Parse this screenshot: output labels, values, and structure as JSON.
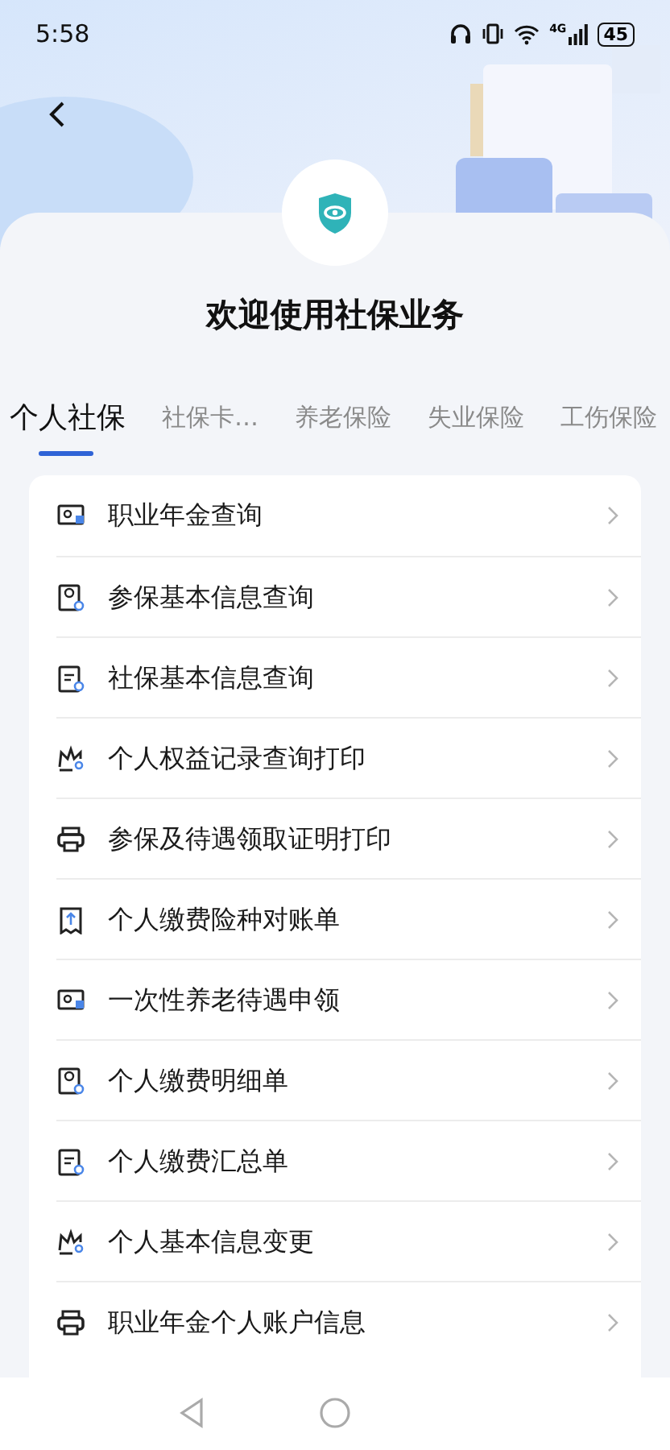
{
  "status_bar": {
    "time": "5:58",
    "network": "4G",
    "battery": "45"
  },
  "header": {
    "title": "欢迎使用社保业务"
  },
  "tabs": [
    {
      "label": "个人社保",
      "selected": true
    },
    {
      "label": "社保卡…",
      "selected": false
    },
    {
      "label": "养老保险",
      "selected": false
    },
    {
      "label": "失业保险",
      "selected": false
    },
    {
      "label": "工伤保险",
      "selected": false
    }
  ],
  "services": [
    {
      "label": "职业年金查询"
    },
    {
      "label": "参保基本信息查询"
    },
    {
      "label": "社保基本信息查询"
    },
    {
      "label": "个人权益记录查询打印"
    },
    {
      "label": "参保及待遇领取证明打印"
    },
    {
      "label": "个人缴费险种对账单"
    },
    {
      "label": "一次性养老待遇申领"
    },
    {
      "label": "个人缴费明细单"
    },
    {
      "label": "个人缴费汇总单"
    },
    {
      "label": "个人基本信息变更"
    },
    {
      "label": "职业年金个人账户信息"
    }
  ]
}
